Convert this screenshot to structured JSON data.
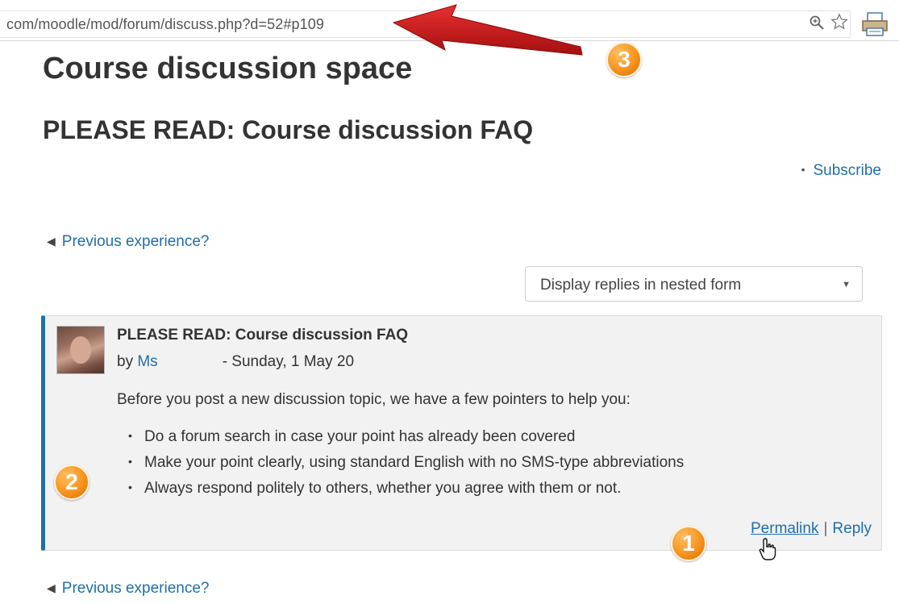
{
  "address_bar": {
    "url": "com/moodle/mod/forum/discuss.php?d=52#p109",
    "icons": [
      "zoom-icon",
      "star-icon",
      "print-icon"
    ]
  },
  "page": {
    "title": "Course discussion space",
    "discussion_title": "PLEASE READ: Course discussion FAQ",
    "subscribe_label": "Subscribe",
    "prev_link_top": "Previous experience?",
    "prev_link_bottom": "Previous experience?",
    "display_mode": "Display replies in nested form"
  },
  "post": {
    "subject": "PLEASE READ: Course discussion FAQ",
    "by_prefix": "by",
    "author": "Ms",
    "date": "- Sunday, 1 May 20",
    "intro": "Before you post a new discussion topic, we have a few pointers to help you:",
    "points": [
      "Do a forum search in case your point has already been covered",
      "Make your point clearly, using standard English with no SMS-type abbreviations",
      "Always respond politely to others, whether you agree with them or not."
    ],
    "permalink_label": "Permalink",
    "separator": "|",
    "reply_label": "Reply"
  },
  "annotations": {
    "badge_1": "1",
    "badge_2": "2",
    "badge_3": "3",
    "colors": {
      "badge": "#f7931e",
      "arrow": "#d11a1a",
      "link": "#1f6fa8",
      "post_border": "#1f6fa8"
    }
  }
}
